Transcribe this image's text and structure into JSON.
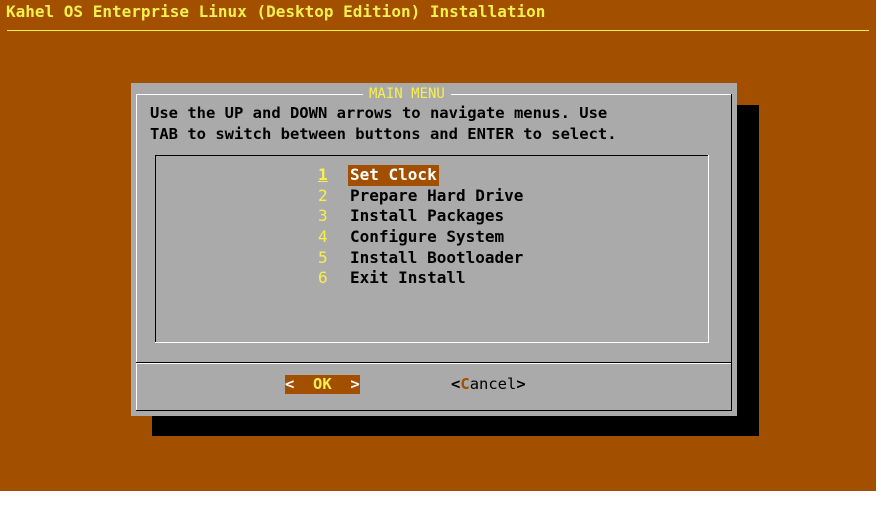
{
  "screen": {
    "backtitle": "Kahel OS Enterprise Linux (Desktop Edition) Installation"
  },
  "dialog": {
    "title": "MAIN MENU",
    "prompt_line1": "Use the UP and DOWN arrows to navigate menus.  Use",
    "prompt_line2": "TAB to switch between buttons and ENTER to select.",
    "menu": {
      "selected_index": 0,
      "items": [
        {
          "key": "1",
          "label": "Set Clock"
        },
        {
          "key": "2",
          "label": "Prepare Hard Drive"
        },
        {
          "key": "3",
          "label": "Install Packages"
        },
        {
          "key": "4",
          "label": "Configure System"
        },
        {
          "key": "5",
          "label": "Install Bootloader"
        },
        {
          "key": "6",
          "label": "Exit Install"
        }
      ]
    },
    "buttons": {
      "ok": {
        "left": "<",
        "label": "OK",
        "right": ">",
        "focused": true
      },
      "cancel": {
        "left": "<",
        "hotkey": "C",
        "rest": "ancel",
        "right": ">",
        "focused": false
      }
    }
  },
  "colors": {
    "background": "#a34f00",
    "dialog": "#aaaaaa",
    "highlight_text": "#f6f04e",
    "shadow": "#000000"
  }
}
